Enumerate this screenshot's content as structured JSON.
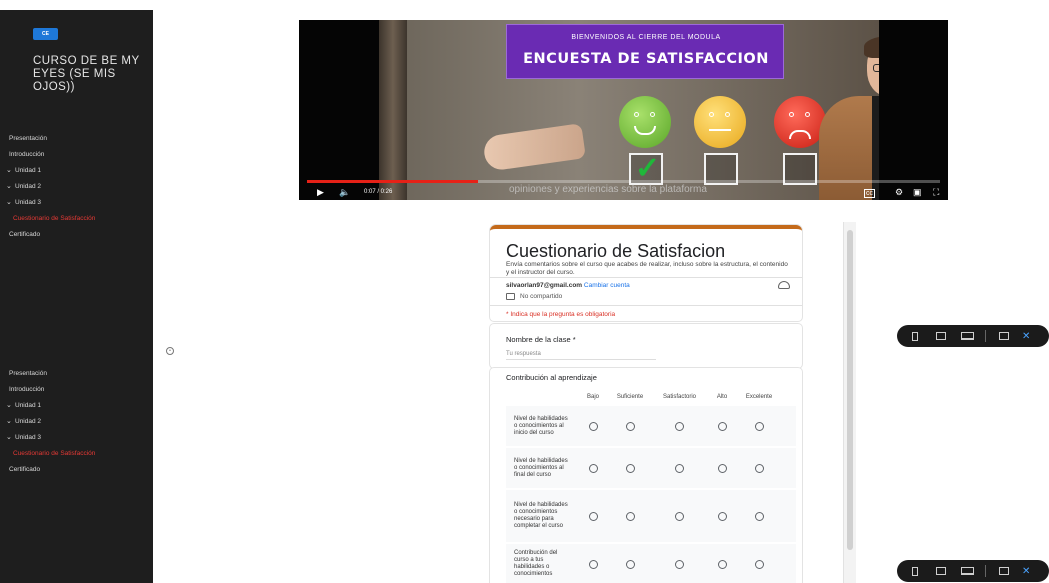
{
  "sidebar": {
    "logo_text": "CE",
    "course_title": "CURSO DE BE MY EYES (SE MIS OJOS))",
    "items": [
      {
        "label": "Presentación",
        "chevron": false,
        "active": false
      },
      {
        "label": "Introducción",
        "chevron": false,
        "active": false
      },
      {
        "label": "Unidad 1",
        "chevron": true,
        "active": false
      },
      {
        "label": "Unidad 2",
        "chevron": true,
        "active": false
      },
      {
        "label": "Unidad 3",
        "chevron": true,
        "active": false
      },
      {
        "label": "Cuestionario de Satisfacción",
        "chevron": false,
        "active": true
      },
      {
        "label": "Certificado",
        "chevron": false,
        "active": false
      }
    ],
    "active_color": "#e53935"
  },
  "video": {
    "banner_subtitle": "BIENVENIDOS AL CIERRE DEL MODULA",
    "banner_title": "ENCUESTA DE SATISFACCION",
    "caption": "opiniones y experiencias sobre la plataforma",
    "time": "0:07 / 0:26",
    "progress": 0.27,
    "accent": "#6a2bb3"
  },
  "form": {
    "title": "Cuestionario de Satisfacion",
    "description": "Envía comentarios sobre el curso que acabes de realizar, incluso sobre la estructura, el contenido y el instructor del curso.",
    "account_email": "silvaorlan97@gmail.com",
    "change_account": "Cambiar cuenta",
    "not_shared": "No compartido",
    "required_note": "* Indica que la pregunta es obligatoria",
    "q1_label": "Nombre de la clase *",
    "q1_placeholder": "Tu respuesta",
    "q2_label": "Contribución al aprendizaje",
    "grid_columns": [
      "Bajo",
      "Suficiente",
      "Satisfactorio",
      "Alto",
      "Excelente"
    ],
    "grid_rows": [
      "Nivel de habilidades o conocimientos al inicio del curso",
      "Nivel de habilidades o conocimientos al final del curso",
      "Nivel de habilidades o conocimientos necesario para completar el curso",
      "Contribución del curso a tus habilidades o conocimientos"
    ],
    "header_color": "#c46a1a"
  }
}
